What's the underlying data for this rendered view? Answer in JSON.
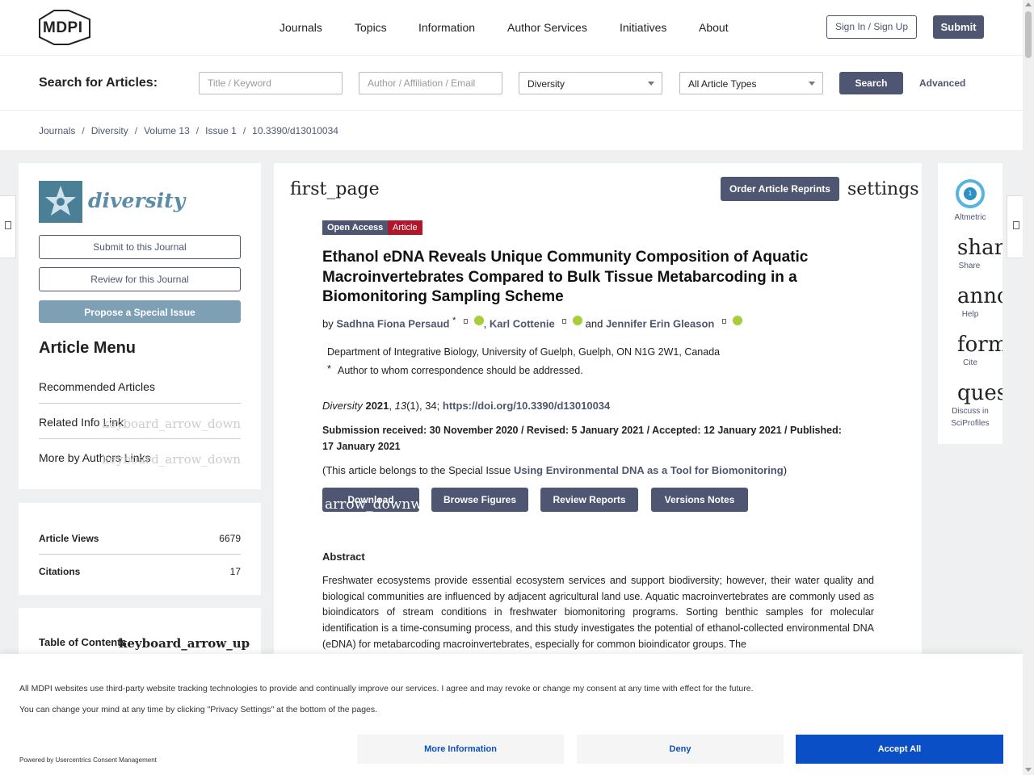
{
  "header": {
    "logo_text": "MDPI",
    "nav": [
      "Journals",
      "Topics",
      "Information",
      "Author Services",
      "Initiatives",
      "About"
    ],
    "sign_in": "Sign In / Sign Up",
    "submit": "Submit"
  },
  "search": {
    "title": "Search for Articles:",
    "keyword_placeholder": "Title / Keyword",
    "author_placeholder": "Author / Affiliation / Email",
    "journal_value": "Diversity",
    "type_value": "All Article Types",
    "search_button": "Search",
    "advanced": "Advanced"
  },
  "breadcrumb": [
    "Journals",
    "Diversity",
    "Volume 13",
    "Issue 1",
    "10.3390/d13010034"
  ],
  "sidebar": {
    "journal_name": "diversity",
    "submit_btn": "Submit to this Journal",
    "review_btn": "Review for this Journal",
    "propose_btn": "Propose a Special Issue",
    "menu_title": "Article Menu",
    "items": [
      {
        "label": "Recommended Articles",
        "icon": ""
      },
      {
        "label": "Related Info Link",
        "icon": "keyboard_arrow_down"
      },
      {
        "label": "More by Authors Links",
        "icon": "keyboard_arrow_down"
      }
    ],
    "stats": [
      {
        "label": "Article Views",
        "value": "6679"
      },
      {
        "label": "Citations",
        "value": "17"
      }
    ],
    "toc_label": "Table of Contents",
    "toc_icon": "keyboard_arrow_up"
  },
  "article": {
    "first_page": "first_page",
    "settings": "settings",
    "order_reprints": "Order Article Reprints",
    "badges": [
      "Open Access",
      "Article"
    ],
    "title": "Ethanol eDNA Reveals Unique Community Composition of Aquatic Macroinvertebrates Compared to Bulk Tissue Metabarcoding in a Biomonitoring Sampling Scheme",
    "by": "by",
    "authors": [
      "Sadhna Fiona Persaud",
      "Karl Cottenie",
      "Jennifer Erin Gleason"
    ],
    "and": "and",
    "author_mark": "*",
    "affiliation": "Department of Integrative Biology, University of Guelph, Guelph, ON N1G 2W1, Canada",
    "corresponding_mark": "*",
    "corresponding": "Author to whom correspondence should be addressed.",
    "journal": "Diversity",
    "year": "2021",
    "volume": "13",
    "issue_page": "(1), 34;",
    "doi": "https://doi.org/10.3390/d13010034",
    "dates": "Submission received: 30 November 2020 / Revised: 5 January 2021 / Accepted: 12 January 2021 / Published: 17 January 2021",
    "special_prefix": "(This article belongs to the Special Issue ",
    "special_link": "Using Environmental DNA as a Tool for Biomonitoring",
    "special_suffix": ")",
    "buttons": [
      "Download",
      "Browse Figures",
      "Review Reports",
      "Versions Notes"
    ],
    "download_icon": "arrow_downward",
    "abstract_title": "Abstract",
    "abstract_text": "Freshwater ecosystems provide essential ecosystem services and support biodiversity; however, their water quality and biological communities are influenced by adjacent agricultural land use. Aquatic macroinvertebrates are commonly used as bioindicators of stream conditions in freshwater biomonitoring programs. Sorting benthic samples for molecular identification is a time-consuming process, and this study investigates the potential of ethanol-collected environmental DNA (eDNA) for metabarcoding macroinvertebrates, especially for common bioindicator groups. The"
  },
  "right_panel": {
    "altmetric_score": "1",
    "altmetric_label": "Altmetric",
    "items": [
      {
        "icon": "share",
        "label": "Share"
      },
      {
        "icon": "announcement",
        "label": "Help"
      },
      {
        "icon": "format_quote",
        "label": "Cite"
      },
      {
        "icon": "question_answer",
        "label": "Discuss in SciProfiles"
      }
    ]
  },
  "consent": {
    "line1": "All MDPI websites use third-party website tracking technologies to provide and continually improve our services. I agree and may revoke or change my consent at any time with effect for the future.",
    "line2": "You can change your mind at any time by clicking \"Privacy Settings\" at the bottom of the pages.",
    "powered": "Powered by Usercentrics Consent Management",
    "more_info": "More Information",
    "deny": "Deny",
    "accept": "Accept All"
  },
  "colors": {
    "brand": "#4f5671",
    "accept": "#0b4fc6",
    "journal_teal": "#4b7f96",
    "badge_article": "#b2162b"
  }
}
